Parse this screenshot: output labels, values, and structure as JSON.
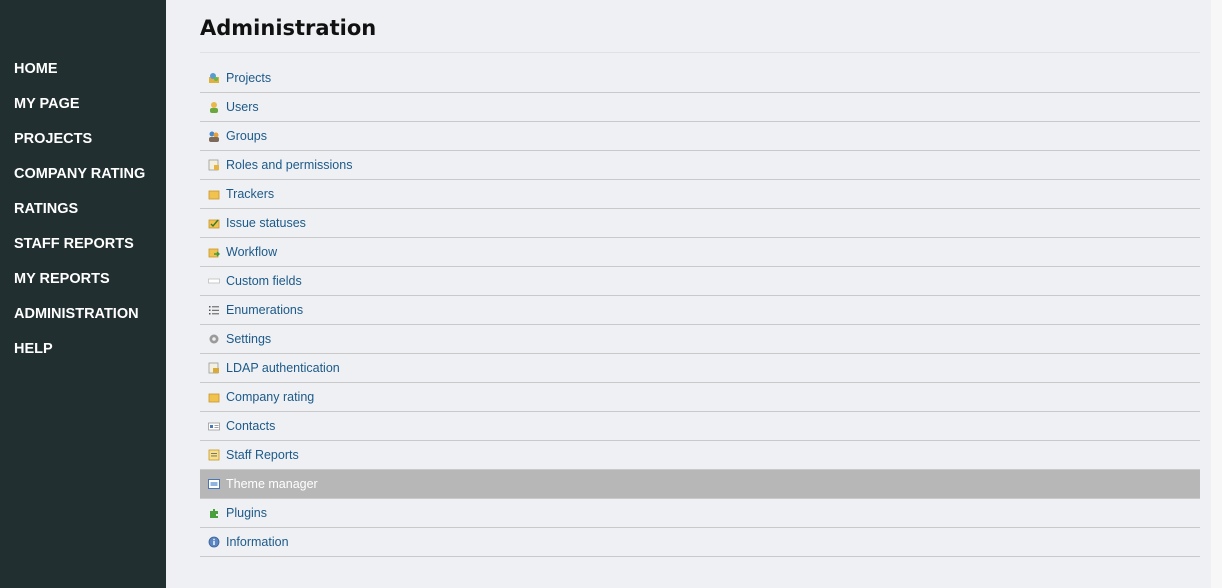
{
  "sidebar": {
    "items": [
      {
        "label": "HOME"
      },
      {
        "label": "MY PAGE"
      },
      {
        "label": "PROJECTS"
      },
      {
        "label": "COMPANY RATING"
      },
      {
        "label": "RATINGS"
      },
      {
        "label": "STAFF REPORTS"
      },
      {
        "label": "MY REPORTS"
      },
      {
        "label": "ADMINISTRATION"
      },
      {
        "label": "HELP"
      }
    ]
  },
  "main": {
    "title": "Administration",
    "menu": [
      {
        "label": "Projects",
        "icon": "projects-icon"
      },
      {
        "label": "Users",
        "icon": "user-icon"
      },
      {
        "label": "Groups",
        "icon": "group-icon"
      },
      {
        "label": "Roles and permissions",
        "icon": "roles-icon"
      },
      {
        "label": "Trackers",
        "icon": "tracker-icon"
      },
      {
        "label": "Issue statuses",
        "icon": "issue-status-icon"
      },
      {
        "label": "Workflow",
        "icon": "workflow-icon"
      },
      {
        "label": "Custom fields",
        "icon": "custom-field-icon"
      },
      {
        "label": "Enumerations",
        "icon": "list-icon"
      },
      {
        "label": "Settings",
        "icon": "gear-icon"
      },
      {
        "label": "LDAP authentication",
        "icon": "ldap-icon"
      },
      {
        "label": "Company rating",
        "icon": "rating-icon"
      },
      {
        "label": "Contacts",
        "icon": "contacts-icon"
      },
      {
        "label": "Staff Reports",
        "icon": "report-icon"
      },
      {
        "label": "Theme manager",
        "icon": "theme-icon"
      },
      {
        "label": "Plugins",
        "icon": "plugin-icon"
      },
      {
        "label": "Information",
        "icon": "info-icon"
      }
    ],
    "active_item": "Theme manager"
  },
  "colors": {
    "sidebar_bg": "#222f30",
    "link": "#1d5a8a",
    "active_bg": "#b7b7b7"
  }
}
